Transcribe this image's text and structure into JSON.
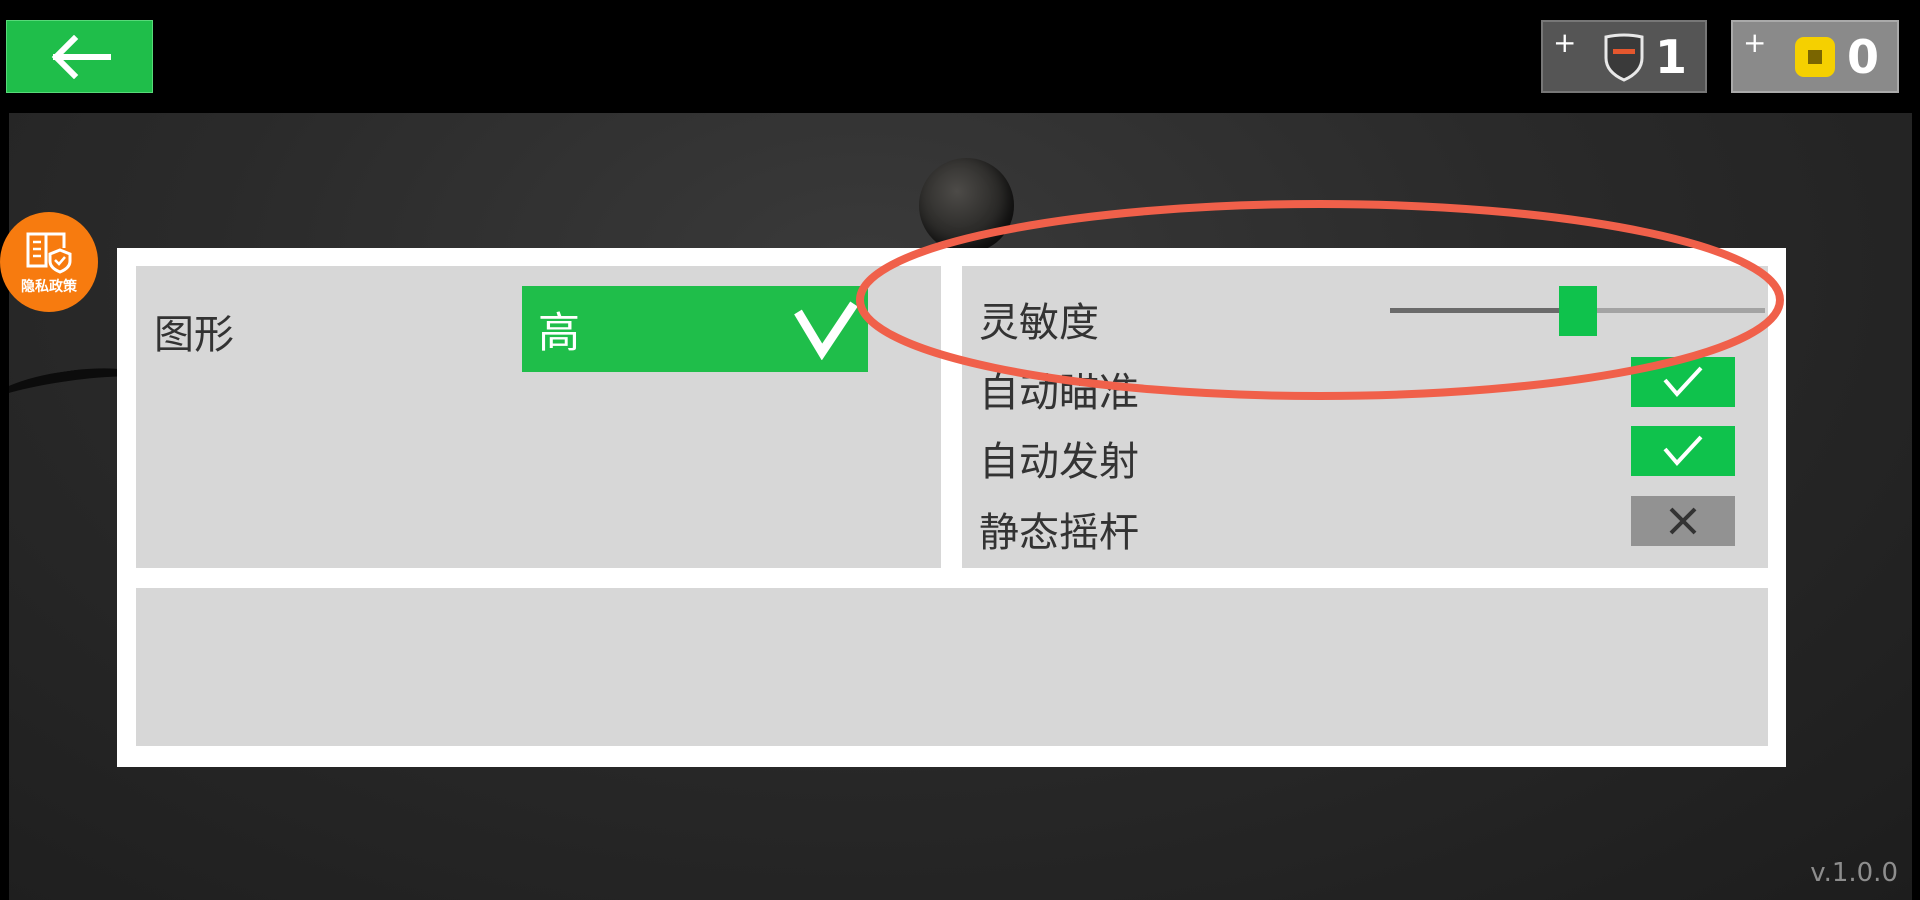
{
  "topbar": {
    "back_icon": "left-arrow-icon",
    "currencies": [
      {
        "plus": "+",
        "icon": "shield-icon",
        "value": "1"
      },
      {
        "plus": "+",
        "icon": "coin-icon",
        "value": "0"
      }
    ]
  },
  "privacy": {
    "label": "隐私政策",
    "icon": "privacy-book-icon"
  },
  "settings": {
    "graphics": {
      "label": "图形",
      "value": "高",
      "icon": "check-icon"
    },
    "sensitivity": {
      "label": "灵敏度",
      "level": 0.5
    },
    "toggles": [
      {
        "label": "自动瞄准",
        "state": "on"
      },
      {
        "label": "自动发射",
        "state": "on"
      },
      {
        "label": "静态摇杆",
        "state": "off"
      }
    ]
  },
  "version": "v.1.0.0",
  "colors": {
    "accent_green": "#1fbe4a",
    "toggle_off": "#929292",
    "privacy_orange": "#f77b0f",
    "highlight_red": "#f0604a"
  }
}
